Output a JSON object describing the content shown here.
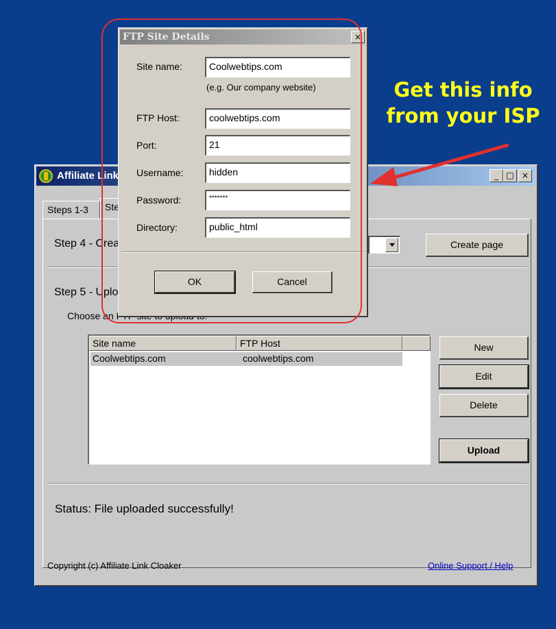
{
  "main_window": {
    "title": "Affiliate Link Cloaker",
    "tabs": [
      {
        "label": "Steps 1-3"
      },
      {
        "label": "Steps 4-5"
      }
    ],
    "step4": {
      "label": "Step 4 - Create a page",
      "create_page_label": "Create page"
    },
    "step5": {
      "label": "Step 5 - Upload the page you created to the Internet:",
      "choose_label": "Choose an FTP site to upload to:"
    },
    "site_list": {
      "columns": [
        "Site name",
        "FTP Host",
        ""
      ],
      "rows": [
        {
          "site_name": "Coolwebtips.com",
          "ftp_host": "coolwebtips.com"
        }
      ]
    },
    "buttons": {
      "new": "New",
      "edit": "Edit",
      "delete": "Delete",
      "upload": "Upload"
    },
    "status": "Status:  File uploaded successfully!",
    "copyright": "Copyright (c) Affiliate Link Cloaker",
    "support_link": "Online Support / Help",
    "caption_buttons": {
      "minimize": "_",
      "maximize": "□",
      "close": "×"
    }
  },
  "ftp_dialog": {
    "title": "FTP Site Details",
    "close": "×",
    "fields": {
      "site_name": {
        "label": "Site name:",
        "value": "Coolwebtips.com"
      },
      "site_name_hint": "(e.g. Our company website)",
      "ftp_host": {
        "label": "FTP Host:",
        "value": "coolwebtips.com"
      },
      "port": {
        "label": "Port:",
        "value": "21"
      },
      "username": {
        "label": "Username:",
        "value": "hidden"
      },
      "password": {
        "label": "Password:",
        "value": "*******"
      },
      "directory": {
        "label": "Directory:",
        "value": "public_html"
      }
    },
    "ok_label": "OK",
    "cancel_label": "Cancel"
  },
  "annotation": {
    "callout_line1": "Get this info",
    "callout_line2": "from your ISP",
    "color": "#ffff1a",
    "ring_color": "#e03030"
  },
  "colors": {
    "desktop": "#0a3d8c",
    "window_face": "#c9c9c9",
    "title_active": "#0a246a",
    "link": "#0000cc"
  }
}
